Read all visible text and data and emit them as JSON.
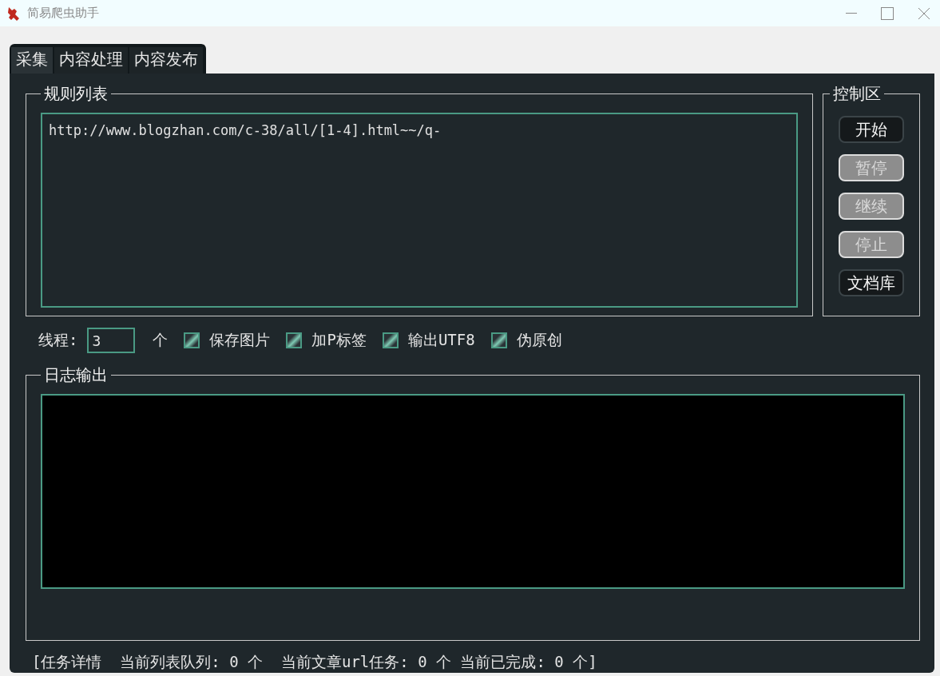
{
  "window": {
    "title": "简易爬虫助手"
  },
  "tabs": [
    {
      "label": "采集",
      "selected": true
    },
    {
      "label": "内容处理",
      "selected": false
    },
    {
      "label": "内容发布",
      "selected": false
    }
  ],
  "rules": {
    "title": "规则列表",
    "value": "http://www.blogzhan.com/c-38/all/[1-4].html~~/q-"
  },
  "control": {
    "title": "控制区",
    "buttons": [
      {
        "label": "开始",
        "disabled": false
      },
      {
        "label": "暂停",
        "disabled": true
      },
      {
        "label": "继续",
        "disabled": true
      },
      {
        "label": "停止",
        "disabled": true
      },
      {
        "label": "文档库",
        "disabled": false
      }
    ]
  },
  "options": {
    "threads_label": "线程:",
    "threads_value": "3",
    "threads_unit": "个",
    "checkboxes": [
      {
        "label": "保存图片",
        "checked": true
      },
      {
        "label": "加P标签",
        "checked": true
      },
      {
        "label": "输出UTF8",
        "checked": true
      },
      {
        "label": "伪原创",
        "checked": true
      }
    ]
  },
  "log": {
    "title": "日志输出"
  },
  "status_bar": "[任务详情  当前列表队列: 0 个  当前文章url任务: 0 个 当前已完成: 0 个]"
}
